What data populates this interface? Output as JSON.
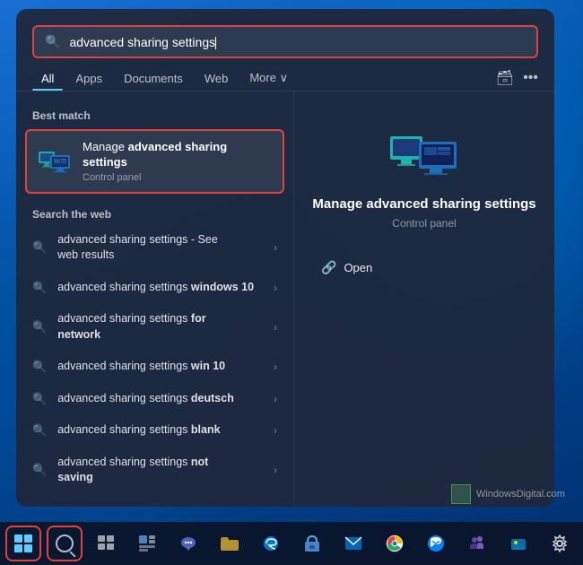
{
  "desktop": {
    "background": "windows11-blue"
  },
  "search_bar": {
    "placeholder": "advanced sharing settings",
    "value": "advanced sharing settings",
    "icon": "search"
  },
  "tabs": {
    "items": [
      {
        "label": "All",
        "active": true
      },
      {
        "label": "Apps",
        "active": false
      },
      {
        "label": "Documents",
        "active": false
      },
      {
        "label": "Web",
        "active": false
      },
      {
        "label": "More ∨",
        "active": false
      }
    ],
    "right_icons": [
      "share-icon",
      "more-icon"
    ]
  },
  "best_match": {
    "section_label": "Best match",
    "item": {
      "title_prefix": "Manage ",
      "title_bold": "advanced sharing",
      "title_suffix": " settings",
      "subtitle": "Control panel",
      "icon": "network-computers"
    }
  },
  "search_web": {
    "section_label": "Search the web",
    "items": [
      {
        "text": "advanced sharing settings",
        "suffix": " - See web results"
      },
      {
        "text_prefix": "advanced sharing settings ",
        "text_bold": "windows 10",
        "text_suffix": ""
      },
      {
        "text_prefix": "advanced sharing settings ",
        "text_bold": "for",
        "text_suffix": "\nnetwork"
      },
      {
        "text_prefix": "advanced sharing settings ",
        "text_bold": "win 10",
        "text_suffix": ""
      },
      {
        "text_prefix": "advanced sharing settings ",
        "text_bold": "deutsch",
        "text_suffix": ""
      },
      {
        "text_prefix": "advanced sharing settings ",
        "text_bold": "blank",
        "text_suffix": ""
      },
      {
        "text_prefix": "advanced sharing settings ",
        "text_bold": "not",
        "text_suffix": "\nsaving"
      }
    ]
  },
  "right_panel": {
    "app_name": "Manage advanced sharing settings",
    "subtitle": "Control panel",
    "open_label": "Open",
    "open_icon": "external-link"
  },
  "watermark": {
    "text": "WindowsDigital.com"
  },
  "taskbar": {
    "items": [
      {
        "icon": "windows-logo",
        "name": "start-button",
        "highlighted": true
      },
      {
        "icon": "search",
        "name": "search-button",
        "highlighted": true
      },
      {
        "icon": "task-view",
        "name": "task-view-button",
        "highlighted": false
      },
      {
        "icon": "widgets",
        "name": "widgets-button",
        "highlighted": false
      },
      {
        "icon": "chat",
        "name": "chat-button",
        "highlighted": false
      },
      {
        "icon": "file-explorer",
        "name": "file-explorer-button",
        "highlighted": false
      },
      {
        "icon": "edge",
        "name": "edge-button",
        "highlighted": false
      },
      {
        "icon": "store",
        "name": "store-button",
        "highlighted": false
      },
      {
        "icon": "mail",
        "name": "mail-button",
        "highlighted": false
      },
      {
        "icon": "chrome",
        "name": "chrome-button",
        "highlighted": false
      },
      {
        "icon": "messenger",
        "name": "messenger-button",
        "highlighted": false
      },
      {
        "icon": "teams",
        "name": "teams-button",
        "highlighted": false
      },
      {
        "icon": "photos",
        "name": "photos-button",
        "highlighted": false
      },
      {
        "icon": "settings",
        "name": "settings-button",
        "highlighted": false
      }
    ]
  }
}
